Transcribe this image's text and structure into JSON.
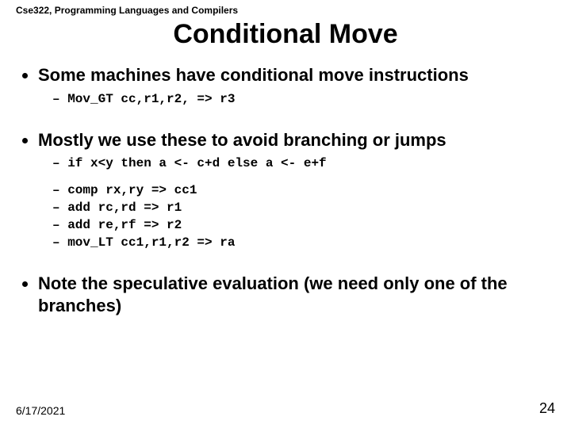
{
  "header": {
    "course": "Cse322, Programming Languages and Compilers"
  },
  "title": "Conditional Move",
  "bullets": {
    "b1": {
      "text": "Some machines have conditional move instructions",
      "code": {
        "l1": "Mov_GT  cc,r1,r2,  => r3"
      }
    },
    "b2": {
      "text": "Mostly we use these to avoid branching or jumps",
      "code": {
        "l1": "if x<y  then   a <- c+d  else  a <- e+f",
        "l2": "comp  rx,ry       => cc1",
        "l3": "add   rc,rd       => r1",
        "l4": "add   re,rf       => r2",
        "l5": "mov_LT   cc1,r1,r2   => ra"
      }
    },
    "b3": {
      "text": "Note the speculative evaluation (we need only one of the branches)"
    }
  },
  "footer": {
    "date": "6/17/2021",
    "page": "24"
  }
}
